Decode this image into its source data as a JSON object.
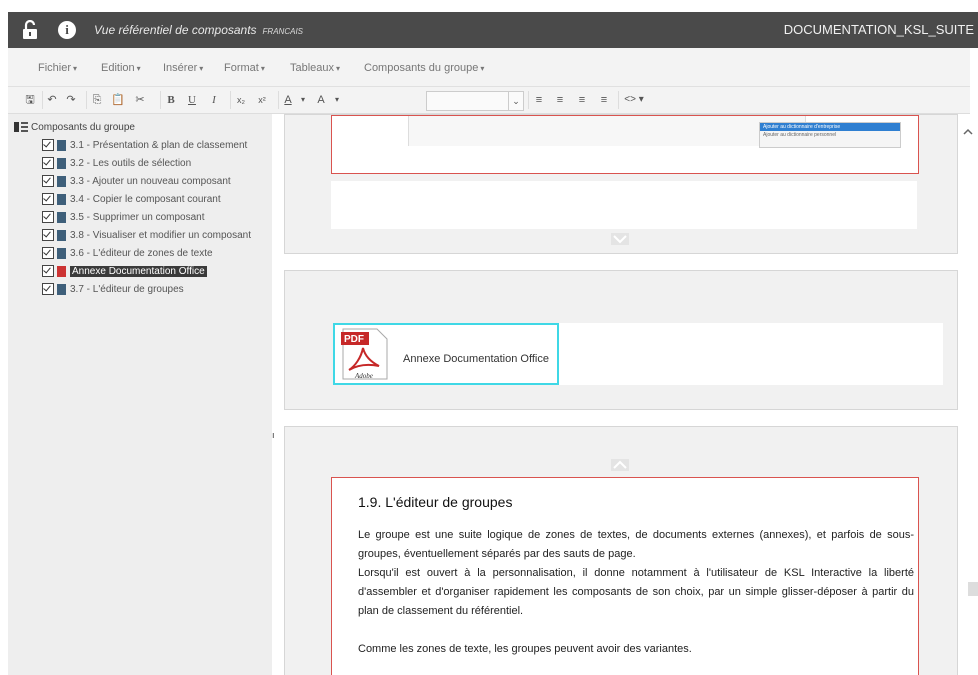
{
  "titlebar": {
    "title": "Vue référentiel de composants",
    "language": "FRANCAIS",
    "document_name": "DOCUMENTATION_KSL_SUITE"
  },
  "menu": [
    {
      "label": "Fichier"
    },
    {
      "label": "Edition"
    },
    {
      "label": "Insérer"
    },
    {
      "label": "Format"
    },
    {
      "label": "Tableaux"
    },
    {
      "label": "Composants du groupe"
    }
  ],
  "toolbar": {
    "bold": "B",
    "underline": "U",
    "italic": "I",
    "subscript": "x₂",
    "superscript": "x²",
    "font_color": "A",
    "highlight_color": "A",
    "code": "<>"
  },
  "tree": {
    "root_label": "Composants du groupe",
    "items": [
      {
        "label": "3.1 - Présentation & plan de classement",
        "type": "doc"
      },
      {
        "label": "3.2 - Les outils de sélection",
        "type": "doc"
      },
      {
        "label": "3.3 - Ajouter un nouveau composant",
        "type": "doc"
      },
      {
        "label": "3.4 - Copier le composant courant",
        "type": "doc"
      },
      {
        "label": "3.5 - Supprimer un composant",
        "type": "doc"
      },
      {
        "label": "3.8 - Visualiser et modifier un composant",
        "type": "doc"
      },
      {
        "label": "3.6 - L'éditeur de zones de texte",
        "type": "doc"
      },
      {
        "label": "Annexe Documentation Office",
        "type": "pdf",
        "selected": true
      },
      {
        "label": "3.7 - L'éditeur de groupes",
        "type": "doc"
      }
    ]
  },
  "preview_menu": {
    "highlighted": "Ajouter au dictionnaire d'entreprise",
    "other": "Ajouter au dictionnaire personnel"
  },
  "annex": {
    "label": "Annexe Documentation Office",
    "pdf_badge": "PDF",
    "brand": "Adobe"
  },
  "document": {
    "heading": "1.9. L'éditeur de groupes",
    "para1": "Le groupe est une suite logique de zones de textes, de documents externes (annexes), et parfois de sous-groupes, éventuellement séparés par des sauts de page.",
    "para2": "Lorsqu'il est ouvert à la personnalisation, il donne notamment à l'utilisateur de KSL Interactive la liberté d'assembler et d'organiser rapidement les composants de son choix, par un simple glisser-déposer à partir du plan de classement du référentiel.",
    "para3": "Comme les zones de texte, les groupes peuvent avoir des variantes."
  },
  "colors": {
    "titlebar": "#4a4a4a",
    "selection_border": "#3fd8e6",
    "section_border": "#d9534f"
  }
}
